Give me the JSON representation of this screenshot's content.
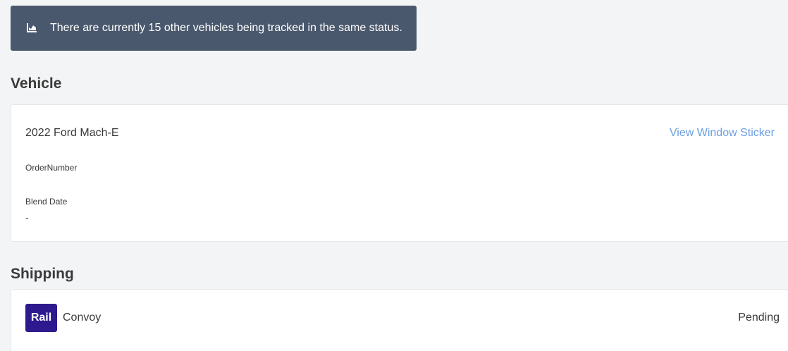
{
  "alert": {
    "icon": "area-chart-icon",
    "message": "There are currently 15 other vehicles being tracked in the same status."
  },
  "vehicle": {
    "section_title": "Vehicle",
    "name": "2022 Ford Mach-E",
    "sticker_link": "View Window Sticker",
    "order_number_label": "OrderNumber",
    "blend_date_label": "Blend Date",
    "blend_date_value": "-"
  },
  "shipping": {
    "section_title": "Shipping",
    "mode_badge": "Rail",
    "carrier": "Convoy",
    "status": "Pending"
  },
  "colors": {
    "alert_bg": "#4a586d",
    "link": "#6a9fe0",
    "rail_badge": "#2e1a8e"
  }
}
